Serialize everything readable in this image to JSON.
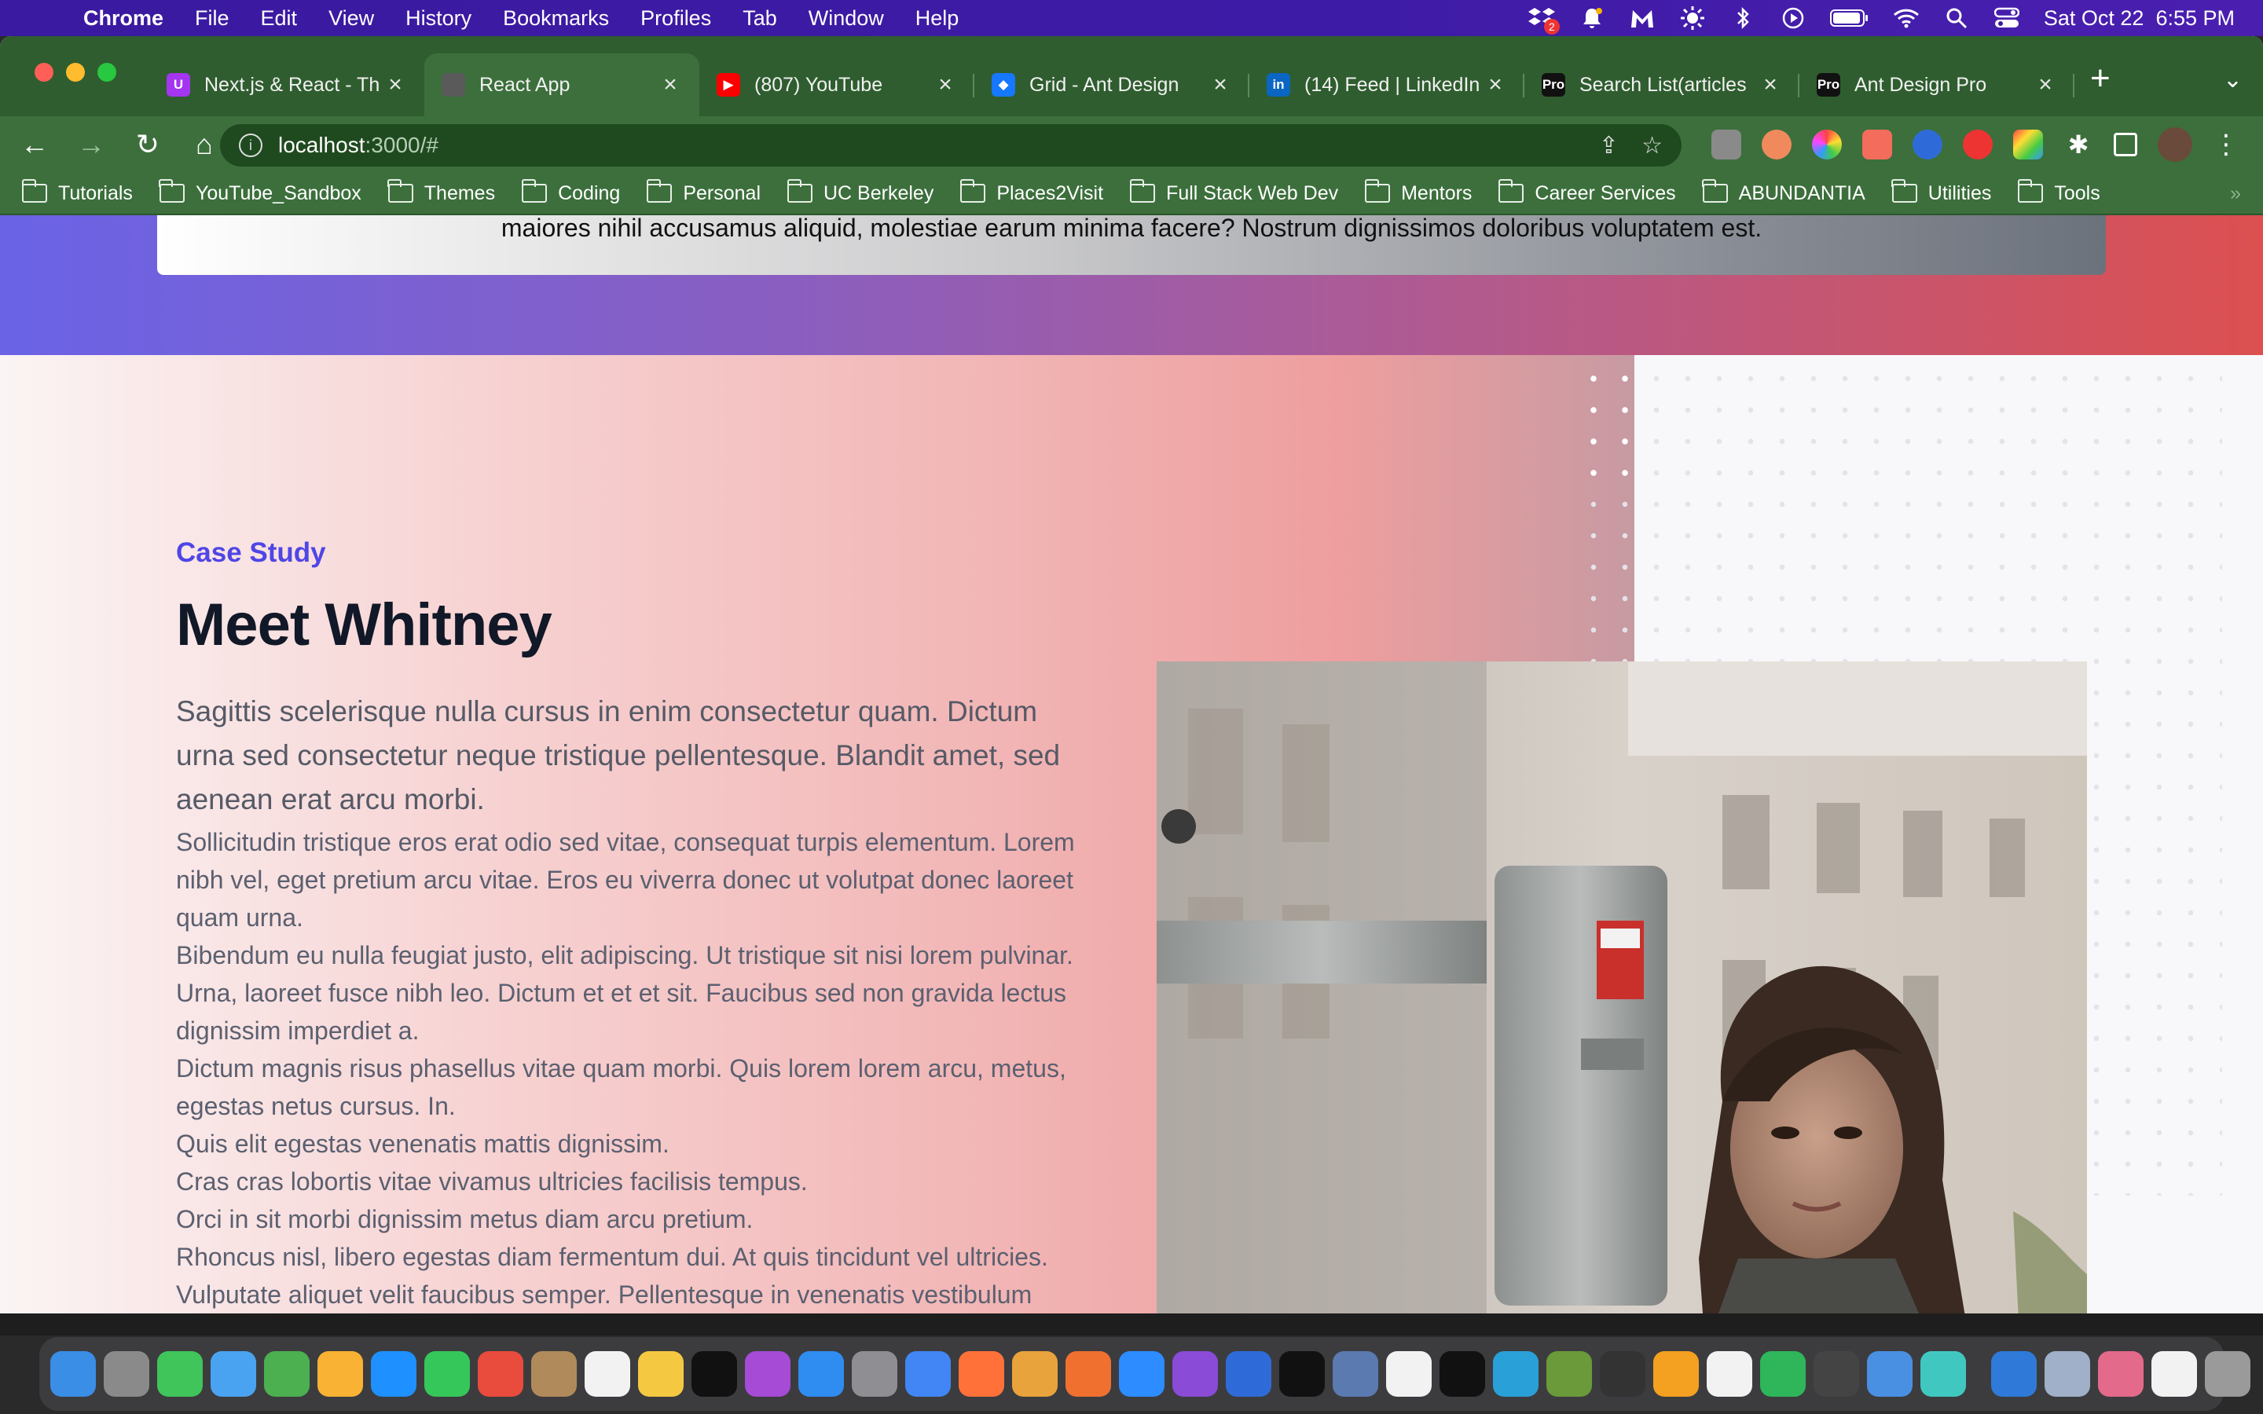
{
  "menubar": {
    "app": "Chrome",
    "items": [
      "File",
      "Edit",
      "View",
      "History",
      "Bookmarks",
      "Profiles",
      "Tab",
      "Window",
      "Help"
    ],
    "clock": "Sat Oct 22  6:55 PM",
    "dropbox_badge": "2"
  },
  "browser": {
    "tabs": [
      {
        "title": "Next.js & React - Th",
        "favicon": "udemy-icon",
        "color": "#a435f0",
        "glyph": "U"
      },
      {
        "title": "React App",
        "favicon": "react-app-icon",
        "color": "#5a5a5a",
        "glyph": ""
      },
      {
        "title": "(807) YouTube",
        "favicon": "youtube-icon",
        "color": "#ff0000",
        "glyph": "▶"
      },
      {
        "title": "Grid - Ant Design",
        "favicon": "ant-design-icon",
        "color": "#1677ff",
        "glyph": "◆"
      },
      {
        "title": "(14) Feed | LinkedIn",
        "favicon": "linkedin-icon",
        "color": "#0a66c2",
        "glyph": "in"
      },
      {
        "title": "Search List(articles",
        "favicon": "ant-pro-icon",
        "color": "#111111",
        "glyph": "Pro"
      },
      {
        "title": "Ant Design Pro",
        "favicon": "ant-pro-icon",
        "color": "#111111",
        "glyph": "Pro"
      }
    ],
    "active_tab": 1,
    "url_host": "localhost",
    "url_path": ":3000/#",
    "bookmarks": [
      "Tutorials",
      "YouTube_Sandbox",
      "Themes",
      "Coding",
      "Personal",
      "UC Berkeley",
      "Places2Visit",
      "Full Stack Web Dev",
      "Mentors",
      "Career Services",
      "ABUNDANTIA",
      "Utilities",
      "Tools"
    ],
    "bookmarks_overflow": "»"
  },
  "page": {
    "hero_text": "maiores nihil accusamus aliquid, molestiae earum minima facere? Nostrum dignissimos doloribus voluptatem est.",
    "eyebrow": "Case Study",
    "title": "Meet Whitney",
    "lead": "Sagittis scelerisque nulla cursus in enim consectetur quam. Dictum urna sed consectetur neque tristique pellentesque. Blandit amet, sed aenean erat arcu morbi.",
    "body_lines": [
      "Sollicitudin tristique eros erat odio sed vitae, consequat turpis elementum. Lorem nibh vel, eget pretium arcu vitae. Eros eu viverra donec ut volutpat donec laoreet quam urna.",
      "Bibendum eu nulla feugiat justo, elit adipiscing. Ut tristique sit nisi lorem pulvinar. Urna, laoreet fusce nibh leo. Dictum et et et sit. Faucibus sed non gravida lectus dignissim imperdiet a.",
      "Dictum magnis risus phasellus vitae quam morbi. Quis lorem lorem arcu, metus, egestas netus cursus. In.",
      "Quis elit egestas venenatis mattis dignissim.",
      "Cras cras lobortis vitae vivamus ultricies facilisis tempus.",
      "Orci in sit morbi dignissim metus diam arcu pretium.",
      "Rhoncus nisl, libero egestas diam fermentum dui. At quis tincidunt vel ultricies. Vulputate aliquet velit faucibus semper. Pellentesque in venenatis vestibulum consectetur nibh id. In id ut tempus egestas. Enim sit aliquam nec, a. Morbi enim"
    ]
  },
  "colors": {
    "accent": "#4f46e5",
    "chrome_theme": "#3c6f3c"
  }
}
